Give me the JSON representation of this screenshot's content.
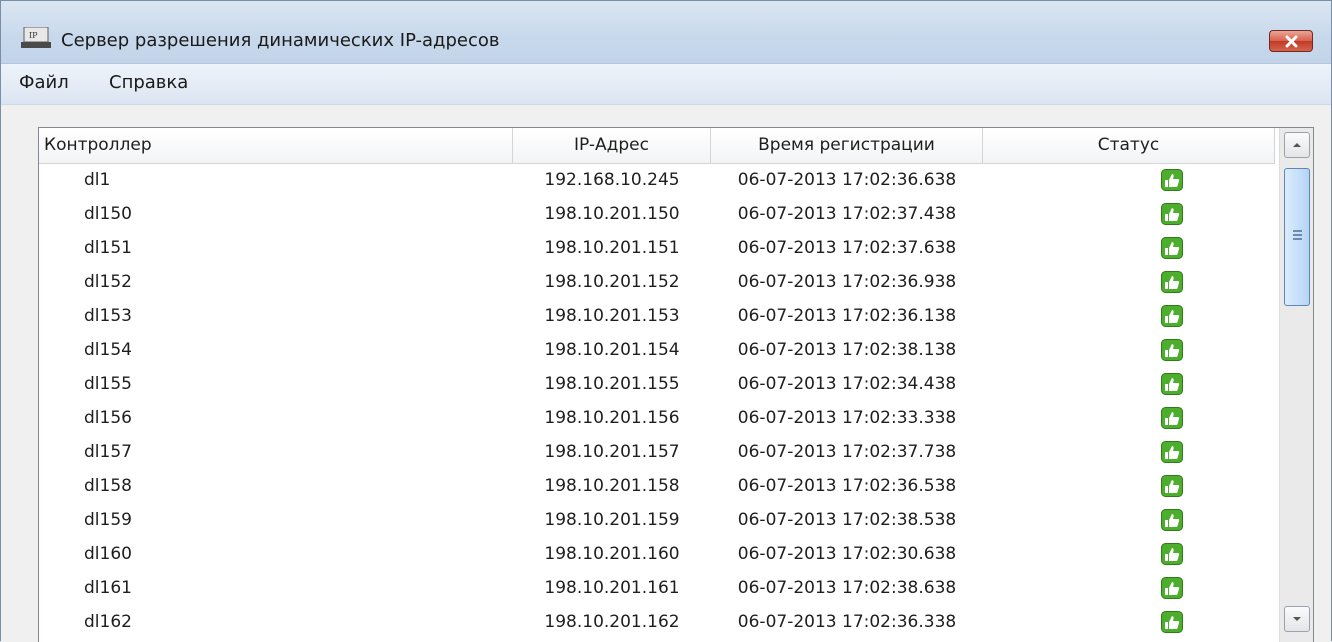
{
  "window": {
    "title": "Сервер разрешения динамических IP-адресов",
    "icon": "app-ip-icon",
    "close_icon": "close-icon"
  },
  "menu": {
    "file": "Файл",
    "help": "Справка"
  },
  "table": {
    "columns": [
      "Контроллер",
      "IP-Адрес",
      "Время регистрации",
      "Статус"
    ],
    "status_icon": "thumbs-up-icon",
    "status_color": "#4cae2c",
    "rows": [
      {
        "name": "dl1",
        "ip": "192.168.10.245",
        "time": "06-07-2013 17:02:36.638"
      },
      {
        "name": "dl150",
        "ip": "198.10.201.150",
        "time": "06-07-2013 17:02:37.438"
      },
      {
        "name": "dl151",
        "ip": "198.10.201.151",
        "time": "06-07-2013 17:02:37.638"
      },
      {
        "name": "dl152",
        "ip": "198.10.201.152",
        "time": "06-07-2013 17:02:36.938"
      },
      {
        "name": "dl153",
        "ip": "198.10.201.153",
        "time": "06-07-2013 17:02:36.138"
      },
      {
        "name": "dl154",
        "ip": "198.10.201.154",
        "time": "06-07-2013 17:02:38.138"
      },
      {
        "name": "dl155",
        "ip": "198.10.201.155",
        "time": "06-07-2013 17:02:34.438"
      },
      {
        "name": "dl156",
        "ip": "198.10.201.156",
        "time": "06-07-2013 17:02:33.338"
      },
      {
        "name": "dl157",
        "ip": "198.10.201.157",
        "time": "06-07-2013 17:02:37.738"
      },
      {
        "name": "dl158",
        "ip": "198.10.201.158",
        "time": "06-07-2013 17:02:36.538"
      },
      {
        "name": "dl159",
        "ip": "198.10.201.159",
        "time": "06-07-2013 17:02:38.538"
      },
      {
        "name": "dl160",
        "ip": "198.10.201.160",
        "time": "06-07-2013 17:02:30.638"
      },
      {
        "name": "dl161",
        "ip": "198.10.201.161",
        "time": "06-07-2013 17:02:38.638"
      },
      {
        "name": "dl162",
        "ip": "198.10.201.162",
        "time": "06-07-2013 17:02:36.338"
      }
    ]
  }
}
